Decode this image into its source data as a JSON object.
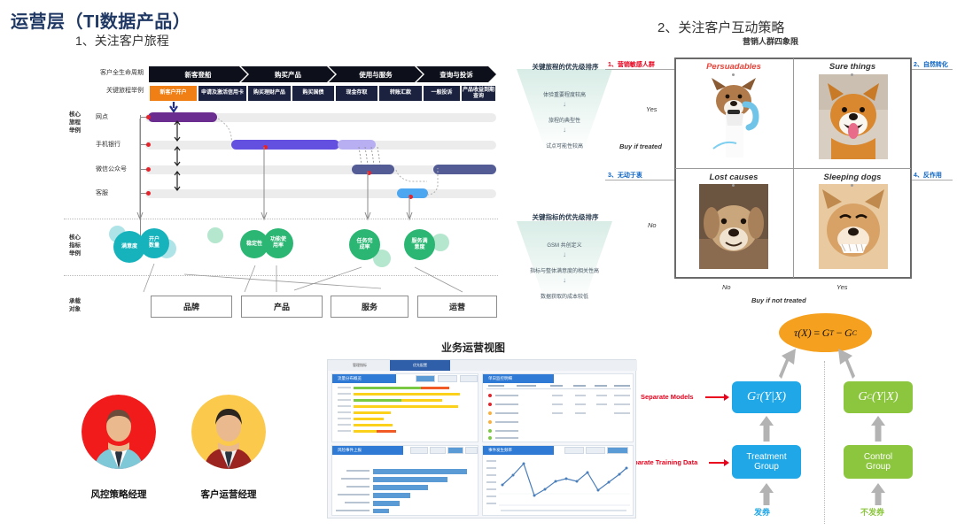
{
  "slide": {
    "main_title": "运营层（TI数据产品）",
    "section1_title": "1、关注客户旅程",
    "section2_title": "2、关注客户互动策略",
    "section2_subtitle": "营销人群四象限",
    "dashboard_title": "业务运营视图"
  },
  "journey": {
    "row_labels": {
      "lifecycle": "客户全生命周期",
      "key_steps": "关键旅程举例",
      "core_journey": "核心\n旅程\n举例",
      "core_journey_lines": [
        "核心",
        "旅程",
        "举例"
      ],
      "core_metric_lines": [
        "核心",
        "指标",
        "举例"
      ],
      "carrier_lines": [
        "承载",
        "对象"
      ]
    },
    "lifecycle_stages": [
      "新客登船",
      "购买产品",
      "使用与服务",
      "查询与投诉"
    ],
    "key_steps": [
      "新客户开户",
      "申请及激活信用卡",
      "购买理财产品",
      "购买国债",
      "现金存取",
      "转账汇款",
      "一般投诉",
      "产品收益到期查询"
    ],
    "highlighted_step": "新客户开户",
    "channels": [
      "网点",
      "手机银行",
      "微信公众号",
      "客服"
    ],
    "metrics": [
      {
        "label": "满意度",
        "color": "#17b3bd"
      },
      {
        "label": "开户\n数量",
        "color": "#17b3bd"
      },
      {
        "label": "稳定性",
        "color": "#2bb673"
      },
      {
        "label": "功能使\n用率",
        "color": "#2bb673"
      },
      {
        "label": "任务完\n成率",
        "color": "#2bb673"
      },
      {
        "label": "服务满\n意度",
        "color": "#2bb673"
      }
    ],
    "carriers": [
      "品牌",
      "产品",
      "服务",
      "运营"
    ]
  },
  "funnels": [
    {
      "title": "关键旅程的优先级排序",
      "items": [
        "体验重要程度较高",
        "旅程的典型性",
        "试点可能性较高"
      ]
    },
    {
      "title": "关键指标的优先级排序",
      "items": [
        "GSM 共创定义",
        "指标与整体满意度的相关性高",
        "数据获取的成本较低"
      ]
    }
  ],
  "quadrant": {
    "cells": [
      {
        "label": "Persuadables",
        "color": "#e8443a"
      },
      {
        "label": "Sure things",
        "color": "#333333"
      },
      {
        "label": "Lost causes",
        "color": "#333333"
      },
      {
        "label": "Sleeping dogs",
        "color": "#333333"
      }
    ],
    "left_labels": [
      {
        "text": "1、营销敏感人群",
        "color": "#e8001c"
      },
      {
        "text": "3、无动于衷",
        "color": "#0b63c5"
      }
    ],
    "right_labels": [
      {
        "text": "2、自然转化",
        "color": "#0b63c5"
      },
      {
        "text": "4、反作用",
        "color": "#0b63c5"
      }
    ],
    "y_ticks": [
      "Yes",
      "No"
    ],
    "y_axis_title": "Buy if treated",
    "x_ticks": [
      "No",
      "Yes"
    ],
    "x_axis_title": "Buy if not treated"
  },
  "uplift": {
    "formula": "τ(X) = G  − G",
    "formula_tau": "τ(X)",
    "formula_eq": "=",
    "formula_gt": "G",
    "formula_gt_sup": "T",
    "formula_minus": "−",
    "formula_gc": "G",
    "formula_gc_sup": "C",
    "treatment_model": "G  (Y |X )",
    "treatment_model_base": "G",
    "treatment_model_sup": "T",
    "treatment_model_args": "(Y|X)",
    "control_model_sup": "C",
    "treatment_group": "Treatment\nGroup",
    "treatment_group_l1": "Treatment",
    "treatment_group_l2": "Group",
    "control_group_l1": "Control",
    "control_group_l2": "Group",
    "annotation_models": "Separate Models",
    "annotation_data": "Separate Training Data",
    "treatment_coupon": "发券",
    "control_coupon": "不发券",
    "treatment_color": "#1fa7e8",
    "control_color": "#8cc63e"
  },
  "personas": [
    {
      "name": "风控策略经理",
      "bg": "#f11b1b",
      "shirt": "#7fc8d8",
      "tie": "#2a3340",
      "hair": "#6b4b3a"
    },
    {
      "name": "客户运营经理",
      "bg": "#fbc94b",
      "shirt": "#9c2420",
      "tie": "#2a3340",
      "hair": "#2b2520"
    }
  ],
  "dashboard": {
    "tabs": [
      "管理指标",
      "优先配置"
    ],
    "active_tab": "优先配置",
    "panels": [
      "流量分布概览",
      "单日监控明细",
      "风险事件上报",
      "事件发生频率"
    ]
  }
}
